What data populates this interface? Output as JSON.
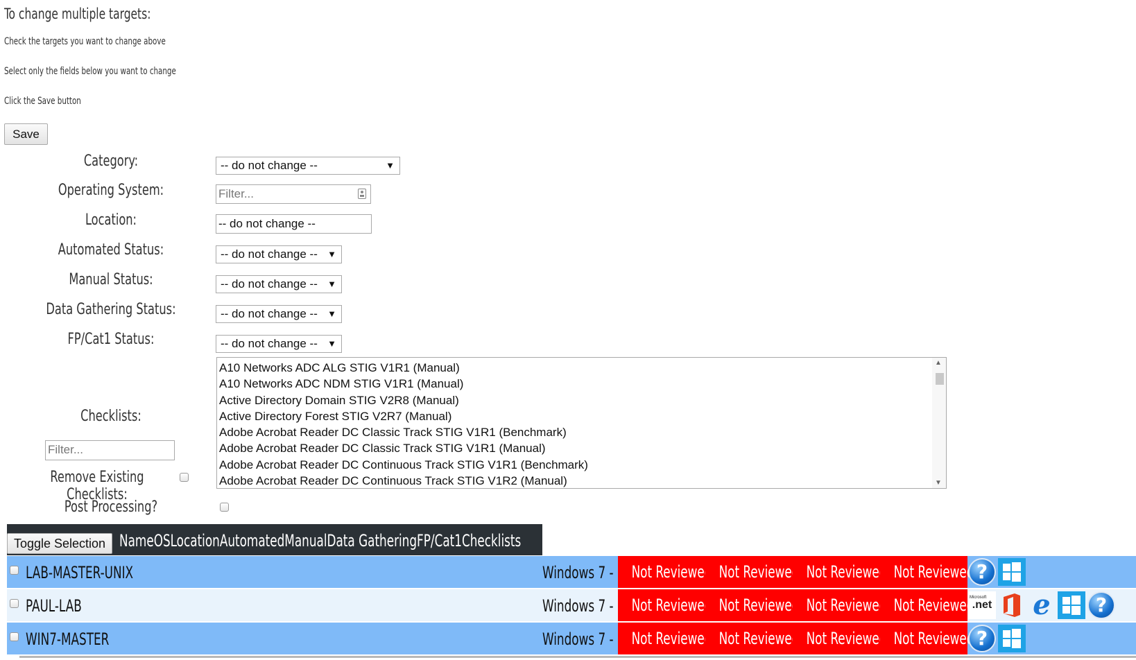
{
  "heading": "To change multiple targets:",
  "instructions": [
    "Check the targets you want to change above",
    "Select only the fields below you want to change",
    "Click the Save button"
  ],
  "save_label": "Save",
  "form": {
    "category": {
      "label": "Category:",
      "value": "-- do not change --"
    },
    "os": {
      "label": "Operating System:",
      "placeholder": "Filter..."
    },
    "location": {
      "label": "Location:",
      "value": "-- do not change --"
    },
    "automated": {
      "label": "Automated Status:",
      "value": "-- do not change --"
    },
    "manual": {
      "label": "Manual Status:",
      "value": "-- do not change --"
    },
    "datagathering": {
      "label": "Data Gathering Status:",
      "value": "-- do not change --"
    },
    "fpcat1": {
      "label": "FP/Cat1 Status:",
      "value": "-- do not change --"
    },
    "checklists": {
      "label": "Checklists:",
      "filter_placeholder": "Filter..."
    },
    "remove_existing": {
      "label": "Remove Existing Checklists:"
    },
    "post_processing": {
      "label": "Post Processing?"
    }
  },
  "checklists": [
    "A10 Networks ADC ALG STIG V1R1 (Manual)",
    "A10 Networks ADC NDM STIG V1R1 (Manual)",
    "Active Directory Domain STIG V2R8 (Manual)",
    "Active Directory Forest STIG V2R7 (Manual)",
    "Adobe Acrobat Reader DC Classic Track STIG V1R1 (Benchmark)",
    "Adobe Acrobat Reader DC Classic Track STIG V1R1 (Manual)",
    "Adobe Acrobat Reader DC Continuous Track STIG V1R1 (Benchmark)",
    "Adobe Acrobat Reader DC Continuous Track STIG V1R2 (Manual)"
  ],
  "table": {
    "toggle_label": "Toggle Selection",
    "columns": "NameOSLocationAutomatedManualData GatheringFP/Cat1Checklists",
    "rows": [
      {
        "name": "LAB-MASTER-UNIX",
        "os": "Windows 7 -",
        "statuses": [
          "Not Reviewed",
          "Not Reviewed",
          "Not Reviewed",
          "Not Reviewed"
        ],
        "icons": [
          "help-icon",
          "windows-icon"
        ]
      },
      {
        "name": "PAUL-LAB",
        "os": "Windows 7 -",
        "statuses": [
          "Not Reviewed",
          "Not Reviewed",
          "Not Reviewed",
          "Not Reviewed"
        ],
        "icons": [
          "dotnet-icon",
          "office-icon",
          "internet-explorer-icon",
          "windows-icon",
          "help-icon"
        ]
      },
      {
        "name": "WIN7-MASTER",
        "os": "Windows 7 -",
        "statuses": [
          "Not Reviewed",
          "Not Reviewed",
          "Not Reviewed",
          "Not Reviewed"
        ],
        "icons": [
          "help-icon",
          "windows-icon"
        ]
      }
    ]
  },
  "icon_text": {
    "dotnet": ".net",
    "dotnet_small": "Microsoft",
    "help": "?",
    "ie": "e"
  },
  "colors": {
    "row_dark": "#7fbaf8",
    "row_light": "#e9f3fc",
    "status_red": "#ff0000",
    "header_bg": "#2b3136"
  }
}
